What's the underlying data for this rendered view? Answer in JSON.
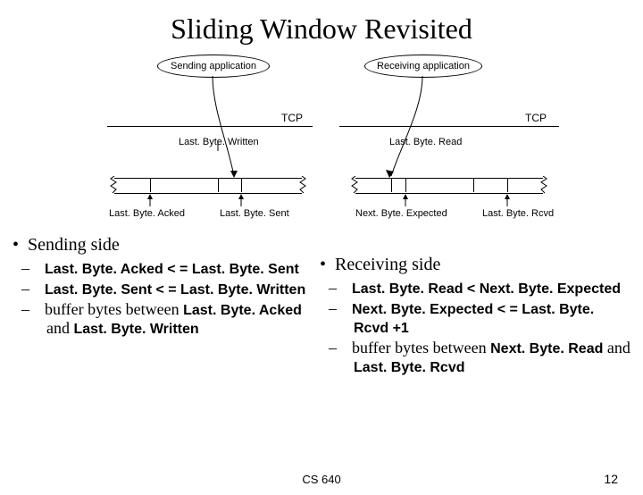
{
  "title": "Sliding Window Revisited",
  "diagram": {
    "sending_app": "Sending application",
    "receiving_app": "Receiving application",
    "tcp_label_left": "TCP",
    "tcp_label_right": "TCP",
    "last_byte_written": "Last. Byte. Written",
    "last_byte_read": "Last. Byte. Read",
    "last_byte_acked": "Last. Byte. Acked",
    "last_byte_sent": "Last. Byte. Sent",
    "next_byte_expected": "Next. Byte. Expected",
    "last_byte_rcvd": "Last. Byte. Rcvd"
  },
  "sending": {
    "header": "Sending side",
    "items": [
      {
        "pre": "Last. Byte. Acked < = Last. Byte. Sent"
      },
      {
        "pre": "Last. Byte. Sent < = Last. Byte. Written"
      },
      {
        "text1": "buffer bytes between ",
        "b1": "Last. Byte. Acked",
        "text2": " and ",
        "b2": "Last. Byte. Written"
      }
    ]
  },
  "receiving": {
    "header": "Receiving side",
    "items": [
      {
        "pre": "Last. Byte. Read < Next. Byte. Expected"
      },
      {
        "pre": "Next. Byte. Expected < = Last. Byte. Rcvd +1"
      },
      {
        "text1": "buffer bytes between ",
        "b1": "Next. Byte. Read",
        "text2": " and ",
        "b2": "Last. Byte. Rcvd"
      }
    ]
  },
  "footer": {
    "course": "CS 640",
    "page": "12"
  }
}
